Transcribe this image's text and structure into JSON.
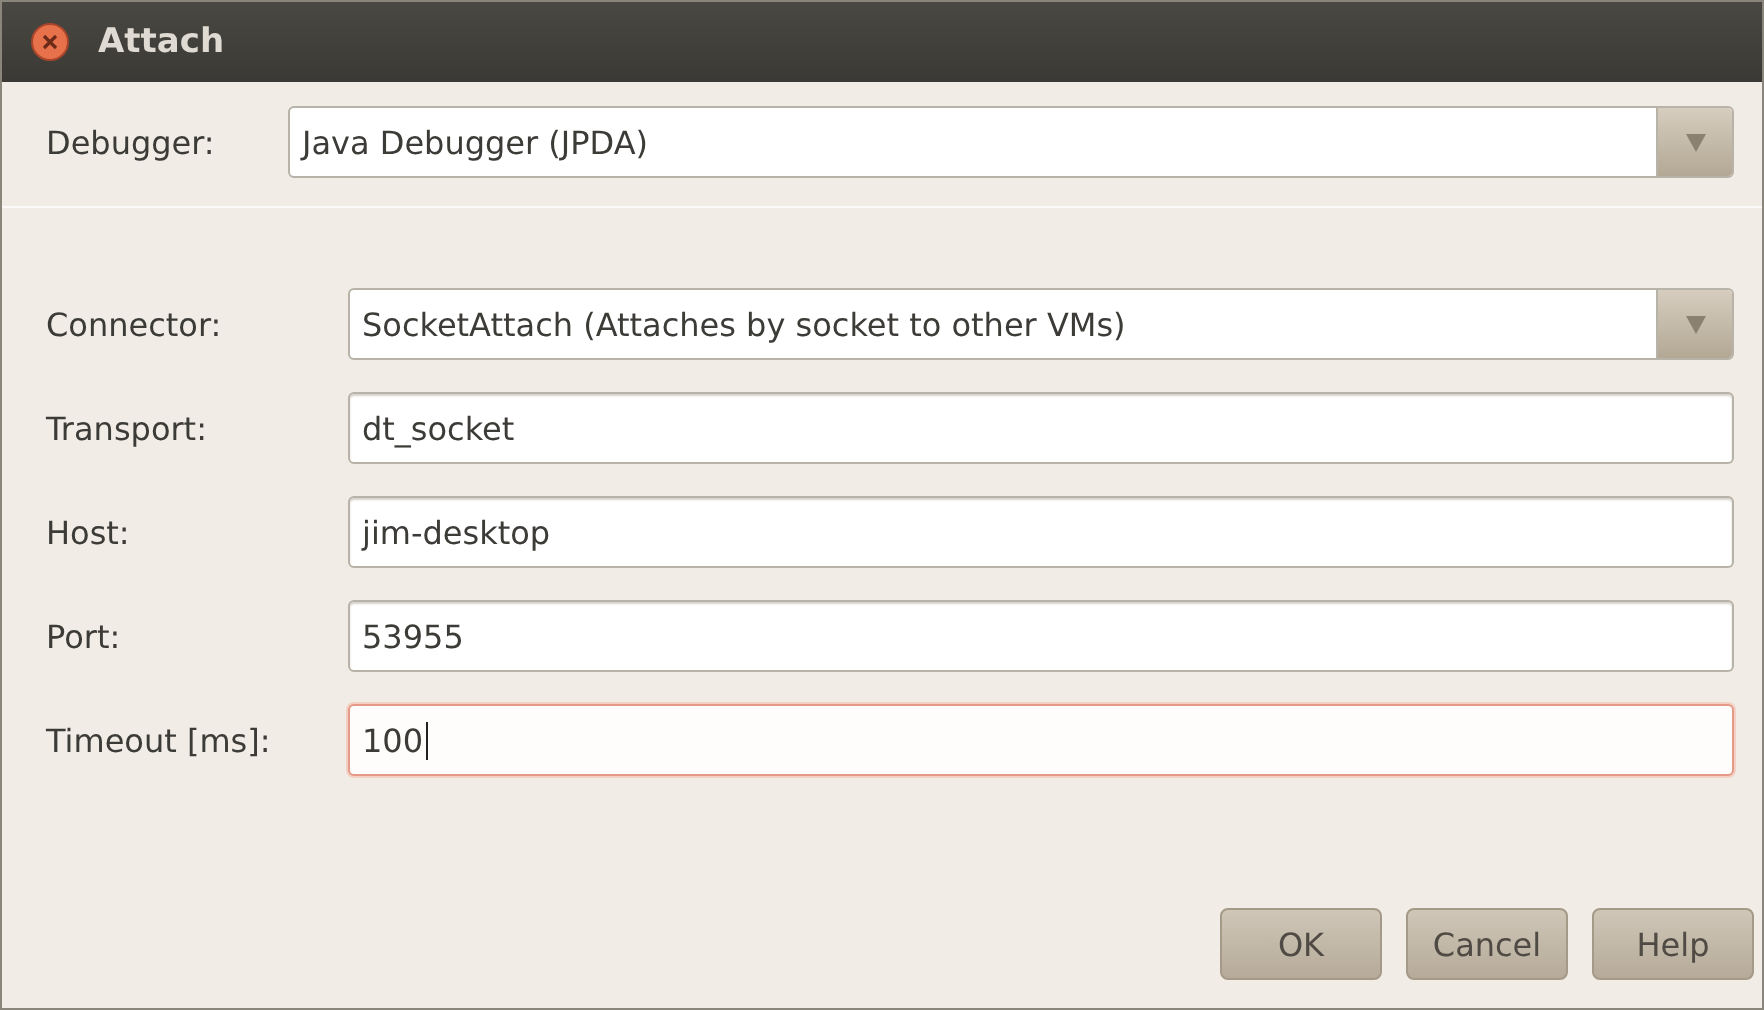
{
  "window": {
    "title": "Attach"
  },
  "debugger": {
    "label": "Debugger:",
    "value": "Java Debugger (JPDA)"
  },
  "fields": [
    {
      "kind": "combo",
      "label": "Connector:",
      "value": "SocketAttach (Attaches by socket to other VMs)",
      "focused": false
    },
    {
      "kind": "text",
      "label": "Transport:",
      "value": "dt_socket",
      "focused": false
    },
    {
      "kind": "text",
      "label": "Host:",
      "value": "jim-desktop",
      "focused": false
    },
    {
      "kind": "text",
      "label": "Port:",
      "value": "53955",
      "focused": false
    },
    {
      "kind": "text",
      "label": "Timeout [ms]:",
      "value": "100",
      "focused": true
    }
  ],
  "buttons": [
    {
      "label": "OK"
    },
    {
      "label": "Cancel"
    },
    {
      "label": "Help"
    }
  ]
}
